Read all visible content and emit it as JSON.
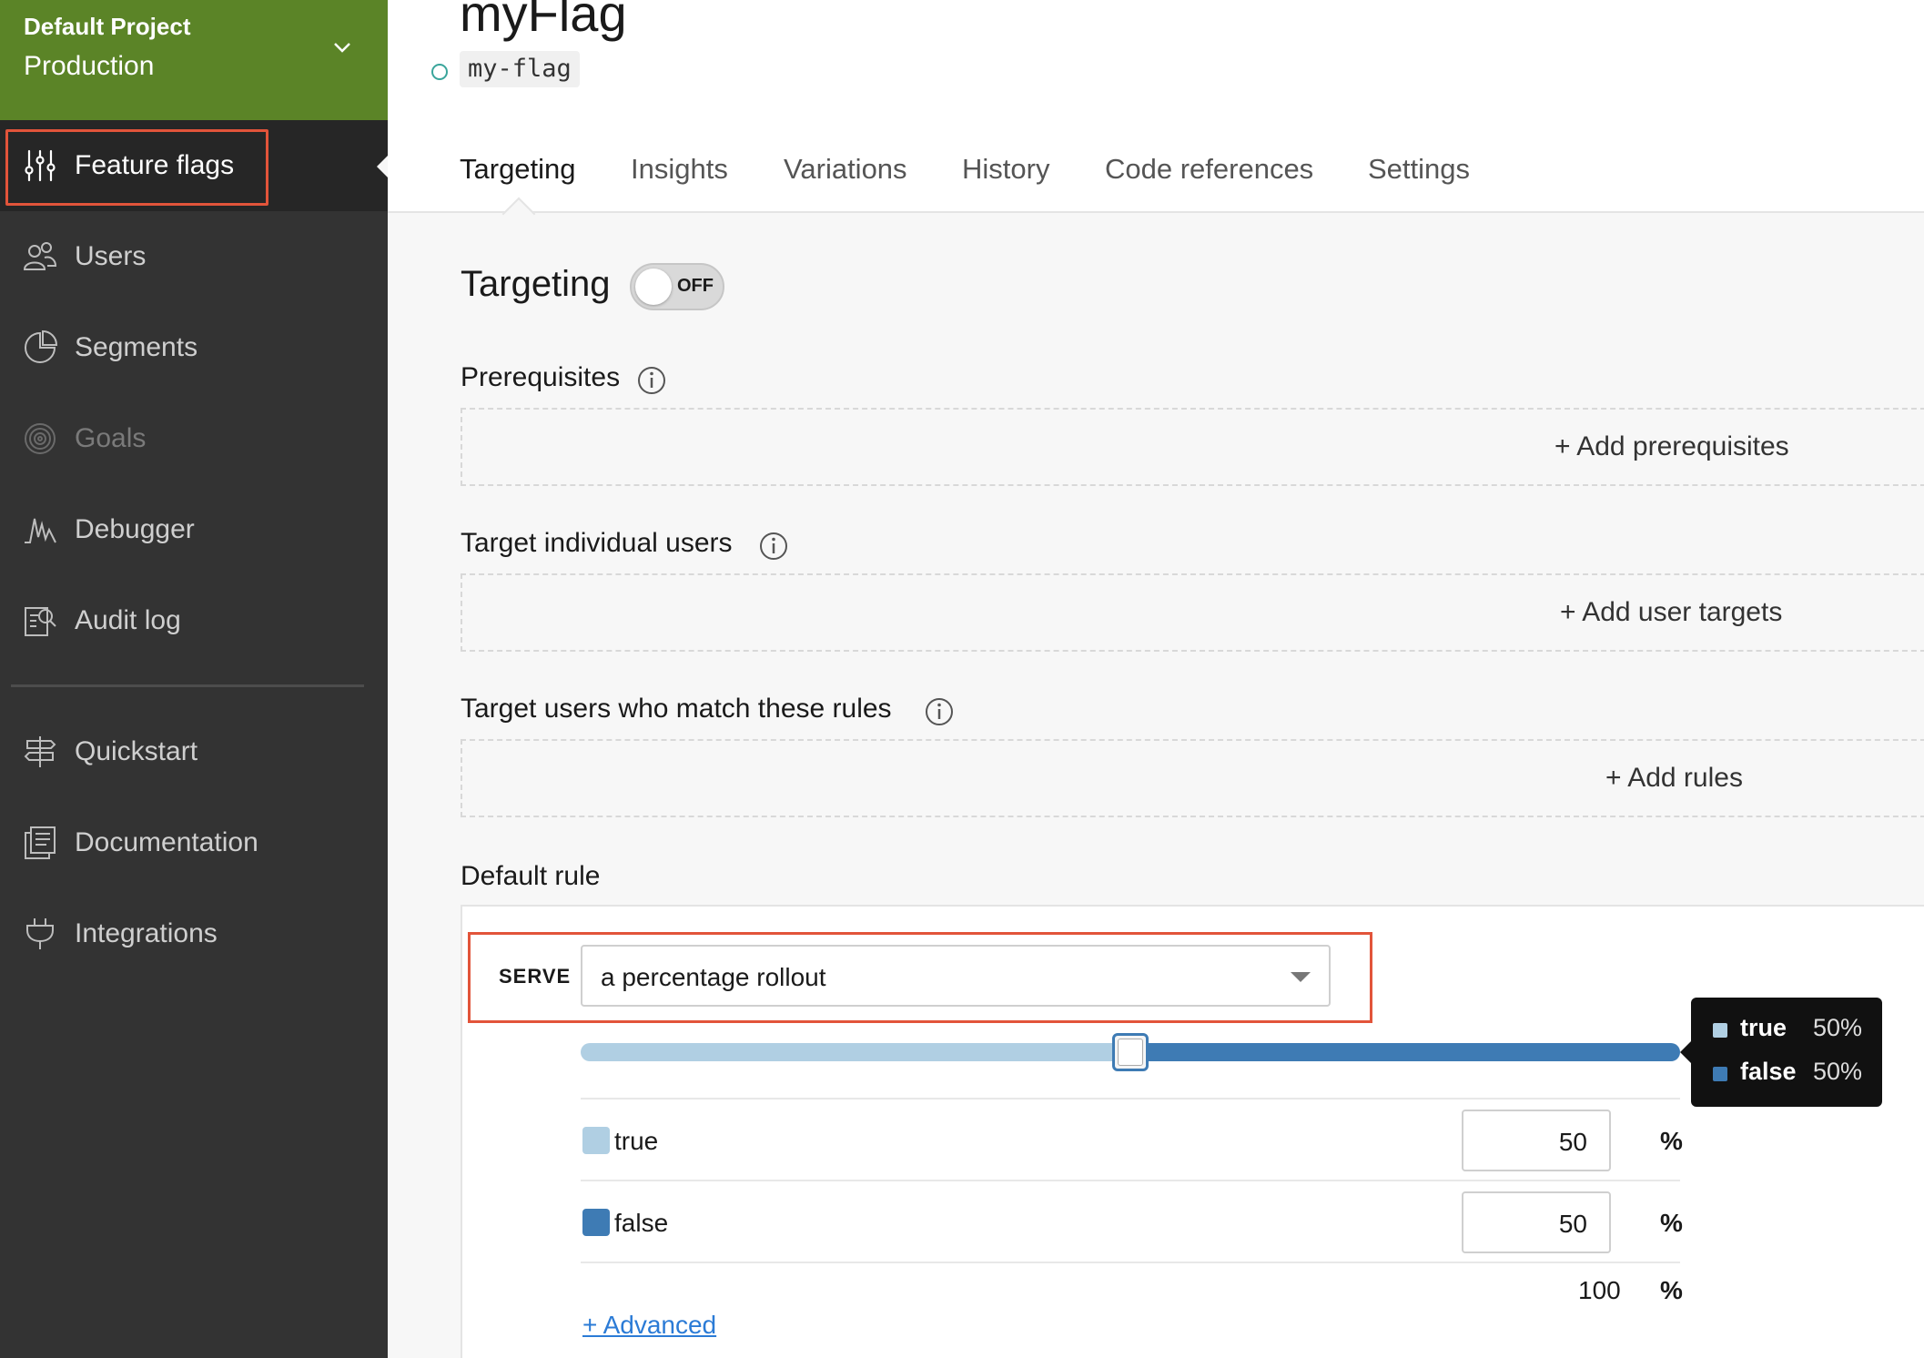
{
  "sidebar": {
    "project_name": "Default Project",
    "environment": "Production",
    "items": [
      {
        "label": "Feature flags",
        "icon": "sliders-icon"
      },
      {
        "label": "Users",
        "icon": "users-icon"
      },
      {
        "label": "Segments",
        "icon": "pie-chart-icon"
      },
      {
        "label": "Goals",
        "icon": "target-icon"
      },
      {
        "label": "Debugger",
        "icon": "activity-icon"
      },
      {
        "label": "Audit log",
        "icon": "document-search-icon"
      },
      {
        "label": "Quickstart",
        "icon": "signpost-icon"
      },
      {
        "label": "Documentation",
        "icon": "docs-icon"
      },
      {
        "label": "Integrations",
        "icon": "plug-icon"
      }
    ]
  },
  "flag": {
    "title": "myFlag",
    "key": "my-flag"
  },
  "tabs": [
    {
      "label": "Targeting",
      "active": true
    },
    {
      "label": "Insights"
    },
    {
      "label": "Variations"
    },
    {
      "label": "History"
    },
    {
      "label": "Code references"
    },
    {
      "label": "Settings"
    }
  ],
  "targeting": {
    "title": "Targeting",
    "toggle_state": "OFF",
    "prerequisites": {
      "title": "Prerequisites",
      "add_label": "+ Add prerequisites"
    },
    "individual": {
      "title": "Target individual users",
      "add_label": "+ Add user targets"
    },
    "rules": {
      "title": "Target users who match these rules",
      "add_label": "+ Add rules"
    },
    "default_rule": {
      "title": "Default rule",
      "serve_label": "SERVE",
      "serve_value": "a percentage rollout",
      "rollout_split": 0.5,
      "variations": [
        {
          "name": "true",
          "percent": "50",
          "color": "#b0cfe3"
        },
        {
          "name": "false",
          "percent": "50",
          "color": "#3e7bb4"
        }
      ],
      "percent_sign": "%",
      "total": "100",
      "advanced_label": "+ Advanced"
    },
    "tooltip": [
      {
        "name": "true",
        "value": "50%"
      },
      {
        "name": "false",
        "value": "50%"
      }
    ]
  },
  "colors": {
    "project_header": "#5b8427",
    "sidebar": "#333333",
    "highlight_outline": "#e2543a",
    "link": "#2b7bd6"
  }
}
